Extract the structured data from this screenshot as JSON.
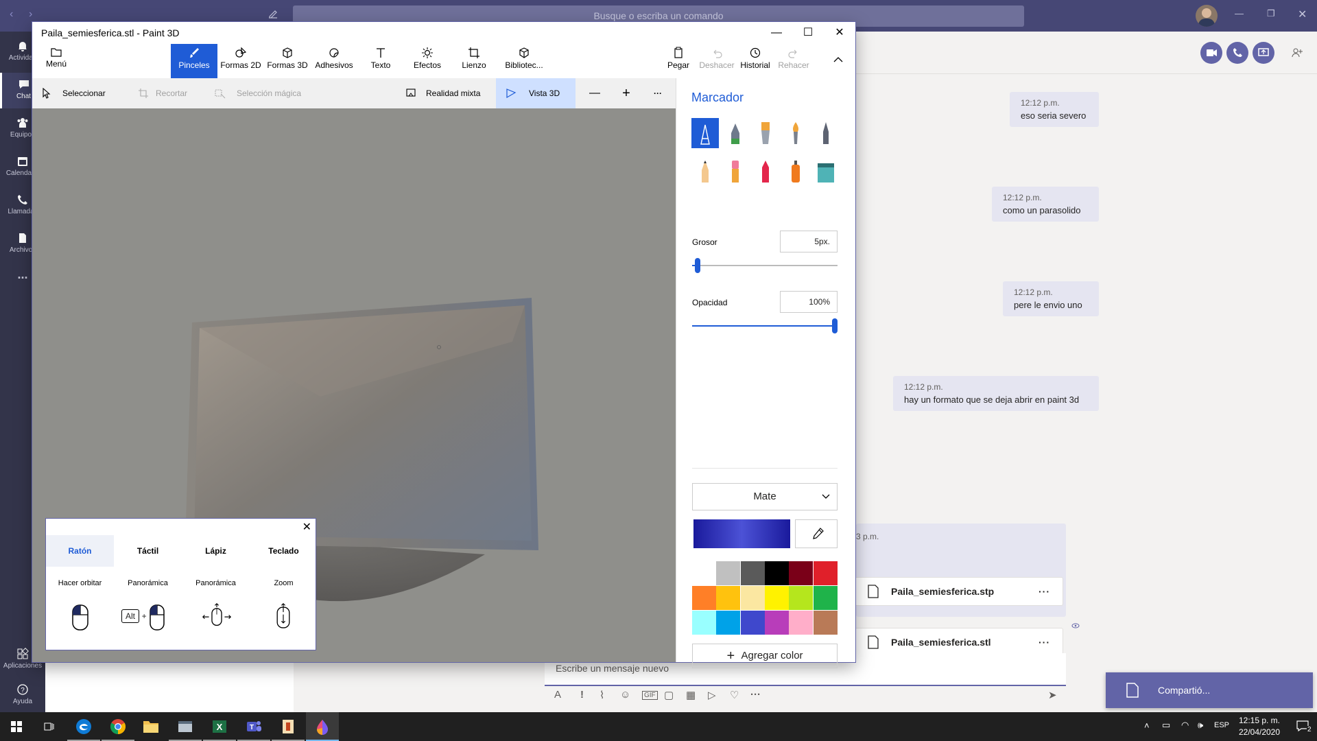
{
  "teams": {
    "search_placeholder": "Busque o escriba un comando",
    "rail": [
      {
        "label": "Actividad",
        "icon": "bell-icon"
      },
      {
        "label": "Chat",
        "icon": "chat-icon"
      },
      {
        "label": "Equipos",
        "icon": "teams-icon"
      },
      {
        "label": "Calendario",
        "icon": "calendar-icon"
      },
      {
        "label": "Llamadas",
        "icon": "phone-icon"
      },
      {
        "label": "Archivos",
        "icon": "file-icon"
      },
      {
        "label": "...",
        "icon": "more-icon"
      },
      {
        "label": "Aplicaciones",
        "icon": "apps-icon"
      },
      {
        "label": "Ayuda",
        "icon": "help-icon"
      }
    ],
    "messages": [
      {
        "time": "12:12 p.m.",
        "text": "eso seria severo"
      },
      {
        "time": "12:12 p.m.",
        "text": "como un parasolido"
      },
      {
        "time": "12:12 p.m.",
        "text": "pere le envio uno"
      },
      {
        "time": "12:12 p.m.",
        "text": "hay un formato que se deja abrir en paint 3d"
      }
    ],
    "files_time_fragment": "3 p.m.",
    "files": [
      {
        "name": "Paila_semiesferica.stp",
        "more": "···"
      },
      {
        "name": "Paila_semiesferica.stl",
        "more": "···"
      }
    ],
    "composer_placeholder": "Escribe un mensaje nuevo",
    "toast": "Compartió..."
  },
  "paint3d": {
    "title": "Paila_semiesferica.stl - Paint 3D",
    "ribbon": [
      {
        "label": "Menú",
        "icon": "folder-icon"
      },
      {
        "label": "Pinceles",
        "icon": "brush-icon",
        "active": true
      },
      {
        "label": "Formas 2D",
        "icon": "shapes-2d-icon"
      },
      {
        "label": "Formas 3D",
        "icon": "cube-icon"
      },
      {
        "label": "Adhesivos",
        "icon": "sticker-icon"
      },
      {
        "label": "Texto",
        "icon": "text-icon"
      },
      {
        "label": "Efectos",
        "icon": "effects-icon"
      },
      {
        "label": "Lienzo",
        "icon": "canvas-icon"
      },
      {
        "label": "Bibliotec...",
        "icon": "library-icon"
      }
    ],
    "ribbon_right": [
      {
        "label": "Pegar",
        "icon": "paste-icon"
      },
      {
        "label": "Deshacer",
        "icon": "undo-icon",
        "disabled": true
      },
      {
        "label": "Historial",
        "icon": "history-icon"
      },
      {
        "label": "Rehacer",
        "icon": "redo-icon",
        "disabled": true
      }
    ],
    "tools": {
      "select": "Seleccionar",
      "crop": "Recortar",
      "magic_select": "Selección mágica",
      "mixed_reality": "Realidad mixta",
      "view3d": "Vista 3D",
      "zoom_out": "—",
      "zoom_in": "+",
      "more": "···"
    },
    "panel": {
      "title": "Marcador",
      "brushes": [
        "marker",
        "calligraphy-pen",
        "oil-brush",
        "watercolor",
        "pixel-pen",
        "pencil",
        "eraser",
        "crayon",
        "spray-can",
        "fill"
      ],
      "thickness_label": "Grosor",
      "thickness_value": "5px.",
      "thickness_fraction": 0.04,
      "opacity_label": "Opacidad",
      "opacity_value": "100%",
      "opacity_fraction": 1.0,
      "finish": "Mate",
      "current_color": "#3b3fc6",
      "palette": [
        "#ffffff",
        "#c0c0c0",
        "#5a5a5a",
        "#000000",
        "#7a0018",
        "#e0202a",
        "#ff7f27",
        "#ffc20e",
        "#fbe7a1",
        "#fff200",
        "#b5e61d",
        "#1fb34a",
        "#99ffff",
        "#00a2e8",
        "#3f48cc",
        "#b83dba",
        "#ffaec9",
        "#b97a57"
      ],
      "add_color": "Agregar color"
    },
    "controls_tip": {
      "tabs": [
        "Ratón",
        "Táctil",
        "Lápiz",
        "Teclado"
      ],
      "actions": [
        "Hacer orbitar",
        "Panorámica",
        "Panorámica",
        "Zoom"
      ],
      "alt_key": "Alt"
    }
  },
  "taskbar": {
    "lang": "ESP",
    "time": "12:15 p. m.",
    "date": "22/04/2020",
    "notifications": "2"
  }
}
